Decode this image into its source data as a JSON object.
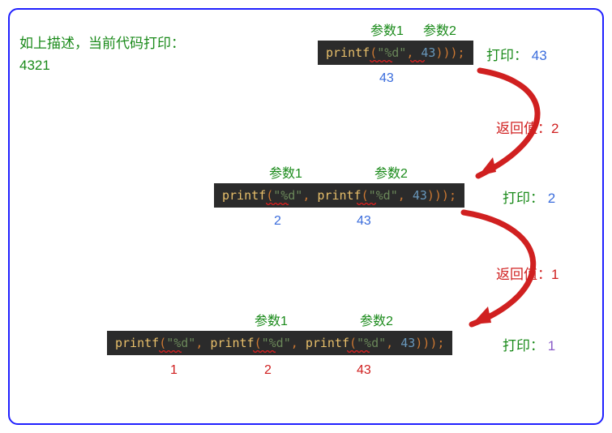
{
  "description": {
    "line1": "如上描述，当前代码打印：",
    "line2": "4321"
  },
  "params": {
    "p1": "参数1",
    "p2": "参数2"
  },
  "code": {
    "printf": "printf",
    "lparen": "(",
    "rparen": ")",
    "fmt": "\"%d\"",
    "comma": ", ",
    "num43": "43",
    "triple_rparen": ")));",
    "double_rparen": "));",
    "semi": ";"
  },
  "under": {
    "v43": "43",
    "v2": "2",
    "v1": "1"
  },
  "output": {
    "print_label": "打印：",
    "return_label": "返回值：",
    "out_43": "43",
    "out_2": "2",
    "out_1": "1",
    "ret_2": "2",
    "ret_1": "1"
  }
}
